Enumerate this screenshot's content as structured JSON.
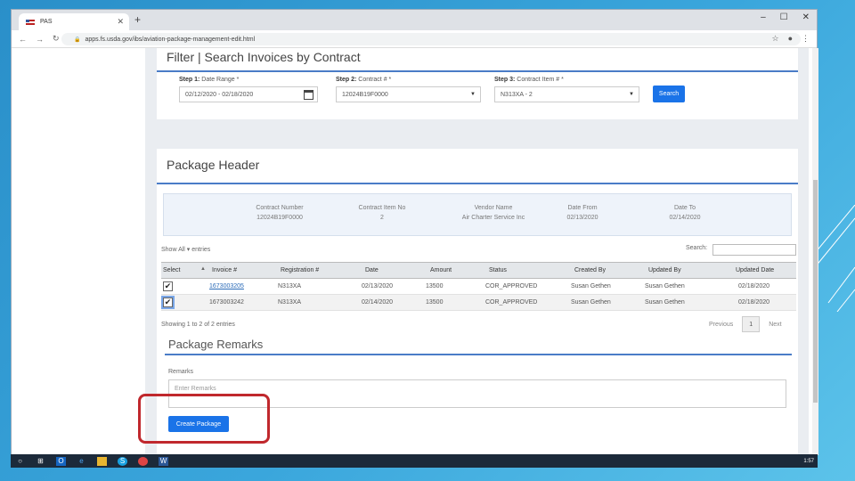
{
  "browser": {
    "tab_title": "PAS",
    "url": "apps.fs.usda.gov/ibs/aviation-package-management-edit.html"
  },
  "filter": {
    "title": "Filter | Search Invoices by Contract",
    "step1": {
      "label_bold": "Step 1:",
      "label": "Date Range *",
      "value": "02/12/2020 - 02/18/2020"
    },
    "step2": {
      "label_bold": "Step 2:",
      "label": "Contract # *",
      "value": "12024B19F0000"
    },
    "step3": {
      "label_bold": "Step 3:",
      "label": "Contract Item # *",
      "value": "N313XA - 2"
    },
    "search_label": "Search"
  },
  "package_header": {
    "title": "Package Header",
    "summary": [
      {
        "label": "Contract Number",
        "value": "12024B19F0000"
      },
      {
        "label": "Contract Item No",
        "value": "2"
      },
      {
        "label": "Vendor Name",
        "value": "Air Charter Service Inc"
      },
      {
        "label": "Date From",
        "value": "02/13/2020"
      },
      {
        "label": "Date To",
        "value": "02/14/2020"
      }
    ],
    "show_entries": "Show  All  ▾  entries",
    "search_label": "Search:",
    "columns": [
      "Select",
      "Invoice #",
      "Registration #",
      "Date",
      "Amount",
      "Status",
      "Created By",
      "Updated By",
      "Updated Date"
    ],
    "rows": [
      {
        "invoice": "1673003205",
        "registration": "N313XA",
        "date": "02/13/2020",
        "amount": "13500",
        "status": "COR_APPROVED",
        "created_by": "Susan Gethen",
        "updated_by": "Susan Gethen",
        "updated_date": "02/18/2020"
      },
      {
        "invoice": "1673003242",
        "registration": "N313XA",
        "date": "02/14/2020",
        "amount": "13500",
        "status": "COR_APPROVED",
        "created_by": "Susan Gethen",
        "updated_by": "Susan Gethen",
        "updated_date": "02/18/2020"
      }
    ],
    "showing": "Showing 1 to 2 of 2 entries",
    "previous": "Previous",
    "page": "1",
    "next": "Next"
  },
  "remarks": {
    "title": "Package Remarks",
    "label": "Remarks",
    "placeholder": "Enter Remarks",
    "create_label": "Create Package"
  },
  "taskbar": {
    "time": "1:57"
  },
  "colors": {
    "accent": "#1a73e8",
    "highlight": "#c0282d",
    "rule": "#4a7cc7"
  }
}
